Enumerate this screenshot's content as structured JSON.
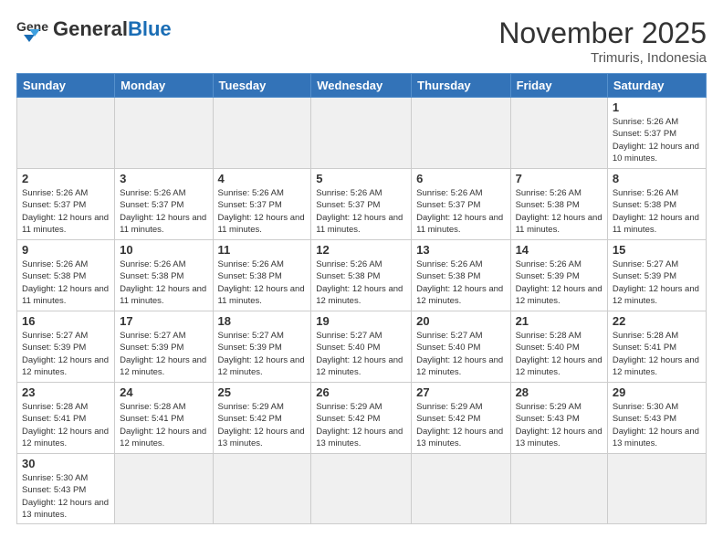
{
  "header": {
    "logo_general": "General",
    "logo_blue": "Blue",
    "month_year": "November 2025",
    "location": "Trimuris, Indonesia"
  },
  "days_of_week": [
    "Sunday",
    "Monday",
    "Tuesday",
    "Wednesday",
    "Thursday",
    "Friday",
    "Saturday"
  ],
  "weeks": [
    [
      {
        "day": "",
        "empty": true
      },
      {
        "day": "",
        "empty": true
      },
      {
        "day": "",
        "empty": true
      },
      {
        "day": "",
        "empty": true
      },
      {
        "day": "",
        "empty": true
      },
      {
        "day": "",
        "empty": true
      },
      {
        "day": "1",
        "info": "Sunrise: 5:26 AM\nSunset: 5:37 PM\nDaylight: 12 hours and 10 minutes."
      }
    ],
    [
      {
        "day": "2",
        "info": "Sunrise: 5:26 AM\nSunset: 5:37 PM\nDaylight: 12 hours and 11 minutes."
      },
      {
        "day": "3",
        "info": "Sunrise: 5:26 AM\nSunset: 5:37 PM\nDaylight: 12 hours and 11 minutes."
      },
      {
        "day": "4",
        "info": "Sunrise: 5:26 AM\nSunset: 5:37 PM\nDaylight: 12 hours and 11 minutes."
      },
      {
        "day": "5",
        "info": "Sunrise: 5:26 AM\nSunset: 5:37 PM\nDaylight: 12 hours and 11 minutes."
      },
      {
        "day": "6",
        "info": "Sunrise: 5:26 AM\nSunset: 5:37 PM\nDaylight: 12 hours and 11 minutes."
      },
      {
        "day": "7",
        "info": "Sunrise: 5:26 AM\nSunset: 5:38 PM\nDaylight: 12 hours and 11 minutes."
      },
      {
        "day": "8",
        "info": "Sunrise: 5:26 AM\nSunset: 5:38 PM\nDaylight: 12 hours and 11 minutes."
      }
    ],
    [
      {
        "day": "9",
        "info": "Sunrise: 5:26 AM\nSunset: 5:38 PM\nDaylight: 12 hours and 11 minutes."
      },
      {
        "day": "10",
        "info": "Sunrise: 5:26 AM\nSunset: 5:38 PM\nDaylight: 12 hours and 11 minutes."
      },
      {
        "day": "11",
        "info": "Sunrise: 5:26 AM\nSunset: 5:38 PM\nDaylight: 12 hours and 11 minutes."
      },
      {
        "day": "12",
        "info": "Sunrise: 5:26 AM\nSunset: 5:38 PM\nDaylight: 12 hours and 12 minutes."
      },
      {
        "day": "13",
        "info": "Sunrise: 5:26 AM\nSunset: 5:38 PM\nDaylight: 12 hours and 12 minutes."
      },
      {
        "day": "14",
        "info": "Sunrise: 5:26 AM\nSunset: 5:39 PM\nDaylight: 12 hours and 12 minutes."
      },
      {
        "day": "15",
        "info": "Sunrise: 5:27 AM\nSunset: 5:39 PM\nDaylight: 12 hours and 12 minutes."
      }
    ],
    [
      {
        "day": "16",
        "info": "Sunrise: 5:27 AM\nSunset: 5:39 PM\nDaylight: 12 hours and 12 minutes."
      },
      {
        "day": "17",
        "info": "Sunrise: 5:27 AM\nSunset: 5:39 PM\nDaylight: 12 hours and 12 minutes."
      },
      {
        "day": "18",
        "info": "Sunrise: 5:27 AM\nSunset: 5:39 PM\nDaylight: 12 hours and 12 minutes."
      },
      {
        "day": "19",
        "info": "Sunrise: 5:27 AM\nSunset: 5:40 PM\nDaylight: 12 hours and 12 minutes."
      },
      {
        "day": "20",
        "info": "Sunrise: 5:27 AM\nSunset: 5:40 PM\nDaylight: 12 hours and 12 minutes."
      },
      {
        "day": "21",
        "info": "Sunrise: 5:28 AM\nSunset: 5:40 PM\nDaylight: 12 hours and 12 minutes."
      },
      {
        "day": "22",
        "info": "Sunrise: 5:28 AM\nSunset: 5:41 PM\nDaylight: 12 hours and 12 minutes."
      }
    ],
    [
      {
        "day": "23",
        "info": "Sunrise: 5:28 AM\nSunset: 5:41 PM\nDaylight: 12 hours and 12 minutes."
      },
      {
        "day": "24",
        "info": "Sunrise: 5:28 AM\nSunset: 5:41 PM\nDaylight: 12 hours and 12 minutes."
      },
      {
        "day": "25",
        "info": "Sunrise: 5:29 AM\nSunset: 5:42 PM\nDaylight: 12 hours and 13 minutes."
      },
      {
        "day": "26",
        "info": "Sunrise: 5:29 AM\nSunset: 5:42 PM\nDaylight: 12 hours and 13 minutes."
      },
      {
        "day": "27",
        "info": "Sunrise: 5:29 AM\nSunset: 5:42 PM\nDaylight: 12 hours and 13 minutes."
      },
      {
        "day": "28",
        "info": "Sunrise: 5:29 AM\nSunset: 5:43 PM\nDaylight: 12 hours and 13 minutes."
      },
      {
        "day": "29",
        "info": "Sunrise: 5:30 AM\nSunset: 5:43 PM\nDaylight: 12 hours and 13 minutes."
      }
    ],
    [
      {
        "day": "30",
        "info": "Sunrise: 5:30 AM\nSunset: 5:43 PM\nDaylight: 12 hours and 13 minutes."
      },
      {
        "day": "",
        "empty": true
      },
      {
        "day": "",
        "empty": true
      },
      {
        "day": "",
        "empty": true
      },
      {
        "day": "",
        "empty": true
      },
      {
        "day": "",
        "empty": true
      },
      {
        "day": "",
        "empty": true
      }
    ]
  ]
}
